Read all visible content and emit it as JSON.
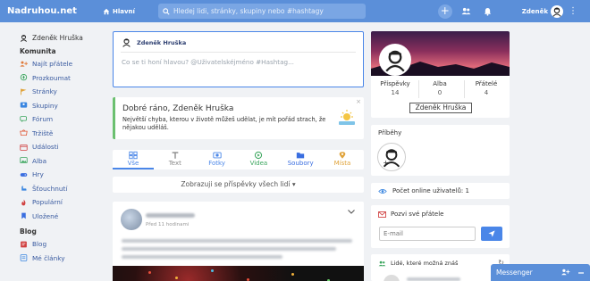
{
  "topbar": {
    "logo": "Nadruhou.net",
    "home_label": "Hlavní",
    "search_placeholder": "Hledej lidi, stránky, skupiny nebo #hashtagy",
    "user_name": "Zdeněk",
    "accent_color": "#5b8fd9"
  },
  "sidebar": {
    "user_name": "Zdeněk Hruška",
    "community_title": "Komunita",
    "community_items": [
      {
        "label": "Najít přátele",
        "icon": "user-plus-icon",
        "color": "#e07a3a"
      },
      {
        "label": "Prozkoumat",
        "icon": "compass-icon",
        "color": "#3aa55d"
      },
      {
        "label": "Stránky",
        "icon": "flag-icon",
        "color": "#e0a33a"
      },
      {
        "label": "Skupiny",
        "icon": "group-icon",
        "color": "#3a86e0"
      },
      {
        "label": "Fórum",
        "icon": "forum-icon",
        "color": "#3aa55d"
      },
      {
        "label": "Tržiště",
        "icon": "market-icon",
        "color": "#e05a3a"
      },
      {
        "label": "Události",
        "icon": "calendar-icon",
        "color": "#d04040"
      },
      {
        "label": "Alba",
        "icon": "album-icon",
        "color": "#3aa55d"
      },
      {
        "label": "Hry",
        "icon": "game-icon",
        "color": "#3a6ee0"
      },
      {
        "label": "Šťouchnutí",
        "icon": "poke-icon",
        "color": "#3a86e0"
      },
      {
        "label": "Populární",
        "icon": "popular-icon",
        "color": "#d04040"
      },
      {
        "label": "Uložené",
        "icon": "bookmark-icon",
        "color": "#3a6ee0"
      }
    ],
    "blog_title": "Blog",
    "blog_items": [
      {
        "label": "Blog",
        "icon": "blog-icon",
        "color": "#d04040"
      },
      {
        "label": "Mé články",
        "icon": "articles-icon",
        "color": "#3a86e0"
      }
    ]
  },
  "composer": {
    "user_name": "Zdeněk Hruška",
    "placeholder": "Co se ti honí hlavou? @Uživatelskéjméno #Hashtag..."
  },
  "greeting": {
    "title": "Dobré ráno, Zdeněk Hruška",
    "text": "Největší chyba, kterou v životě můžeš udělat, je mít pořád strach, že nějakou uděláš.",
    "close": "×"
  },
  "tabs": [
    {
      "label": "Vše",
      "icon": "all-icon",
      "color": "#4a86e8"
    },
    {
      "label": "Text",
      "icon": "text-icon",
      "color": "#888888"
    },
    {
      "label": "Fotky",
      "icon": "photo-icon",
      "color": "#4a86e8"
    },
    {
      "label": "Videa",
      "icon": "video-icon",
      "color": "#3aa55d"
    },
    {
      "label": "Soubory",
      "icon": "file-icon",
      "color": "#3a6ee0"
    },
    {
      "label": "Místa",
      "icon": "place-icon",
      "color": "#e0a33a"
    }
  ],
  "filter": {
    "label": "Zobrazuji se příspěvky všech lidí ▾"
  },
  "post": {
    "time": "Před 11 hodinami"
  },
  "profile": {
    "name": "Zdeněk Hruška",
    "stats": [
      {
        "label": "Příspěvky",
        "value": "14"
      },
      {
        "label": "Alba",
        "value": "0"
      },
      {
        "label": "Přátelé",
        "value": "4"
      }
    ]
  },
  "stories": {
    "title": "Příběhy"
  },
  "online": {
    "label": "Počet online uživatelů: 1"
  },
  "invite": {
    "title": "Pozvi své přátele",
    "placeholder": "E-mail"
  },
  "people": {
    "title": "Lidé, které možná znáš"
  },
  "messenger": {
    "label": "Messenger"
  }
}
